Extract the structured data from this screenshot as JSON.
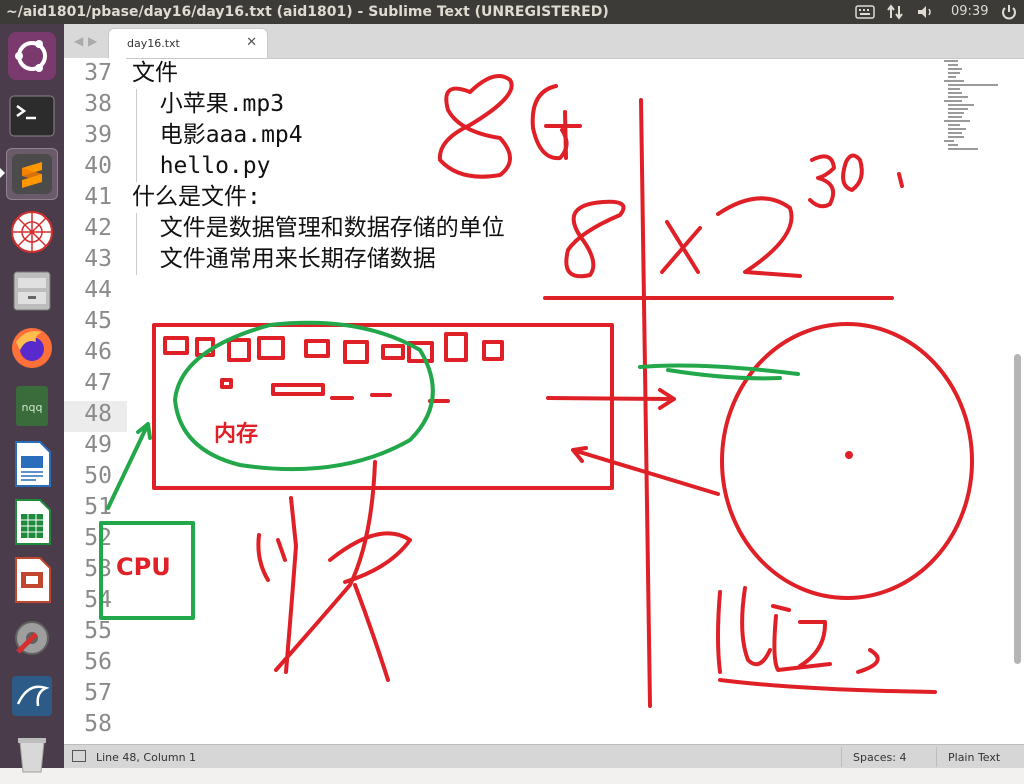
{
  "window": {
    "title": "~/aid1801/pbase/day16/day16.txt (aid1801) - Sublime Text (UNREGISTERED)"
  },
  "panel": {
    "clock": "09:39",
    "indicators": [
      "keyboard-icon",
      "network-icon",
      "volume-icon",
      "power-icon"
    ]
  },
  "launcher": {
    "items": [
      {
        "name": "ubuntu-dash",
        "icon": "ubuntu-logo-icon",
        "color": "#dd4814"
      },
      {
        "name": "terminal",
        "icon": "terminal-icon",
        "color": "#2c2c2c"
      },
      {
        "name": "sublime-text",
        "icon": "sublime-text-icon",
        "color": "#ff9800",
        "active": true
      },
      {
        "name": "network-web",
        "icon": "web-icon",
        "color": "#d32f2f"
      },
      {
        "name": "files",
        "icon": "files-icon",
        "color": "#8d8d8d"
      },
      {
        "name": "firefox",
        "icon": "firefox-icon",
        "color": "#ff7139"
      },
      {
        "name": "nqq",
        "icon": "nqq-icon",
        "label": "nqq",
        "color": "#3a6b3a"
      },
      {
        "name": "writer",
        "icon": "libreoffice-writer-icon",
        "color": "#2a6ebb"
      },
      {
        "name": "calc",
        "icon": "libreoffice-calc-icon",
        "color": "#1e8a3c"
      },
      {
        "name": "impress",
        "icon": "libreoffice-impress-icon",
        "color": "#c0462d"
      },
      {
        "name": "settings",
        "icon": "system-settings-icon",
        "color": "#8a8a8a"
      },
      {
        "name": "mysql-workbench",
        "icon": "mysql-workbench-icon",
        "color": "#2c5b87"
      },
      {
        "name": "trash",
        "icon": "trash-icon",
        "color": "#c9c9c9"
      }
    ]
  },
  "editor": {
    "tab": {
      "label": "day16.txt"
    },
    "line_numbers": [
      "37",
      "38",
      "39",
      "40",
      "41",
      "42",
      "43",
      "44",
      "45",
      "46",
      "47",
      "48",
      "49",
      "50",
      "51",
      "52",
      "53",
      "54",
      "55",
      "56",
      "57",
      "58"
    ],
    "current_line": "48",
    "lines": [
      "文件",
      "  小苹果.mp3",
      "  电影aaa.mp4",
      "  hello.py",
      "什么是文件:",
      "  文件是数据管理和数据存储的单位",
      "  文件通常用来长期存储数据",
      "",
      "",
      "",
      "",
      "",
      "",
      "",
      "",
      "",
      "",
      "",
      "",
      "",
      "",
      ""
    ]
  },
  "annotations": {
    "memory_label": "内存",
    "cpu_label": "CPU",
    "handwriting_color": "#e02027",
    "cpu_box_color": "#22a84a"
  },
  "statusbar": {
    "position": "Line 48, Column 1",
    "spaces": "Spaces: 4",
    "syntax": "Plain Text"
  }
}
